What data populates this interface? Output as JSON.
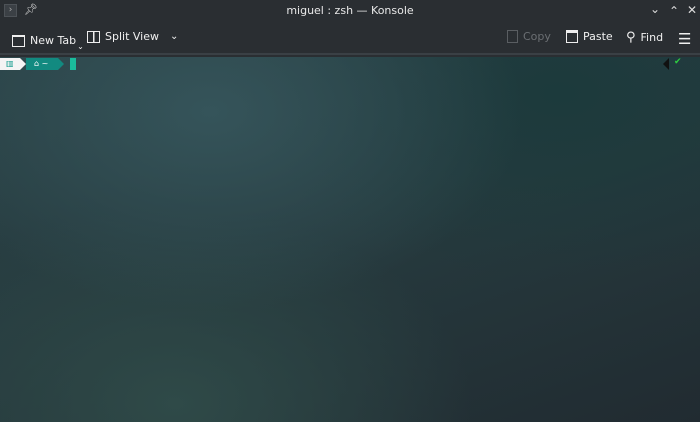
{
  "window": {
    "title": "miguel : zsh — Konsole"
  },
  "toolbar": {
    "new_tab": "New Tab",
    "split_view": "Split View",
    "copy": "Copy",
    "paste": "Paste",
    "find": "Find"
  },
  "prompt": {
    "os_icon": "manjaro-icon",
    "home_icon": "home-icon",
    "dir": "~",
    "status": "✔"
  },
  "colors": {
    "accent": "#1abc9c",
    "segment": "#128a80"
  }
}
